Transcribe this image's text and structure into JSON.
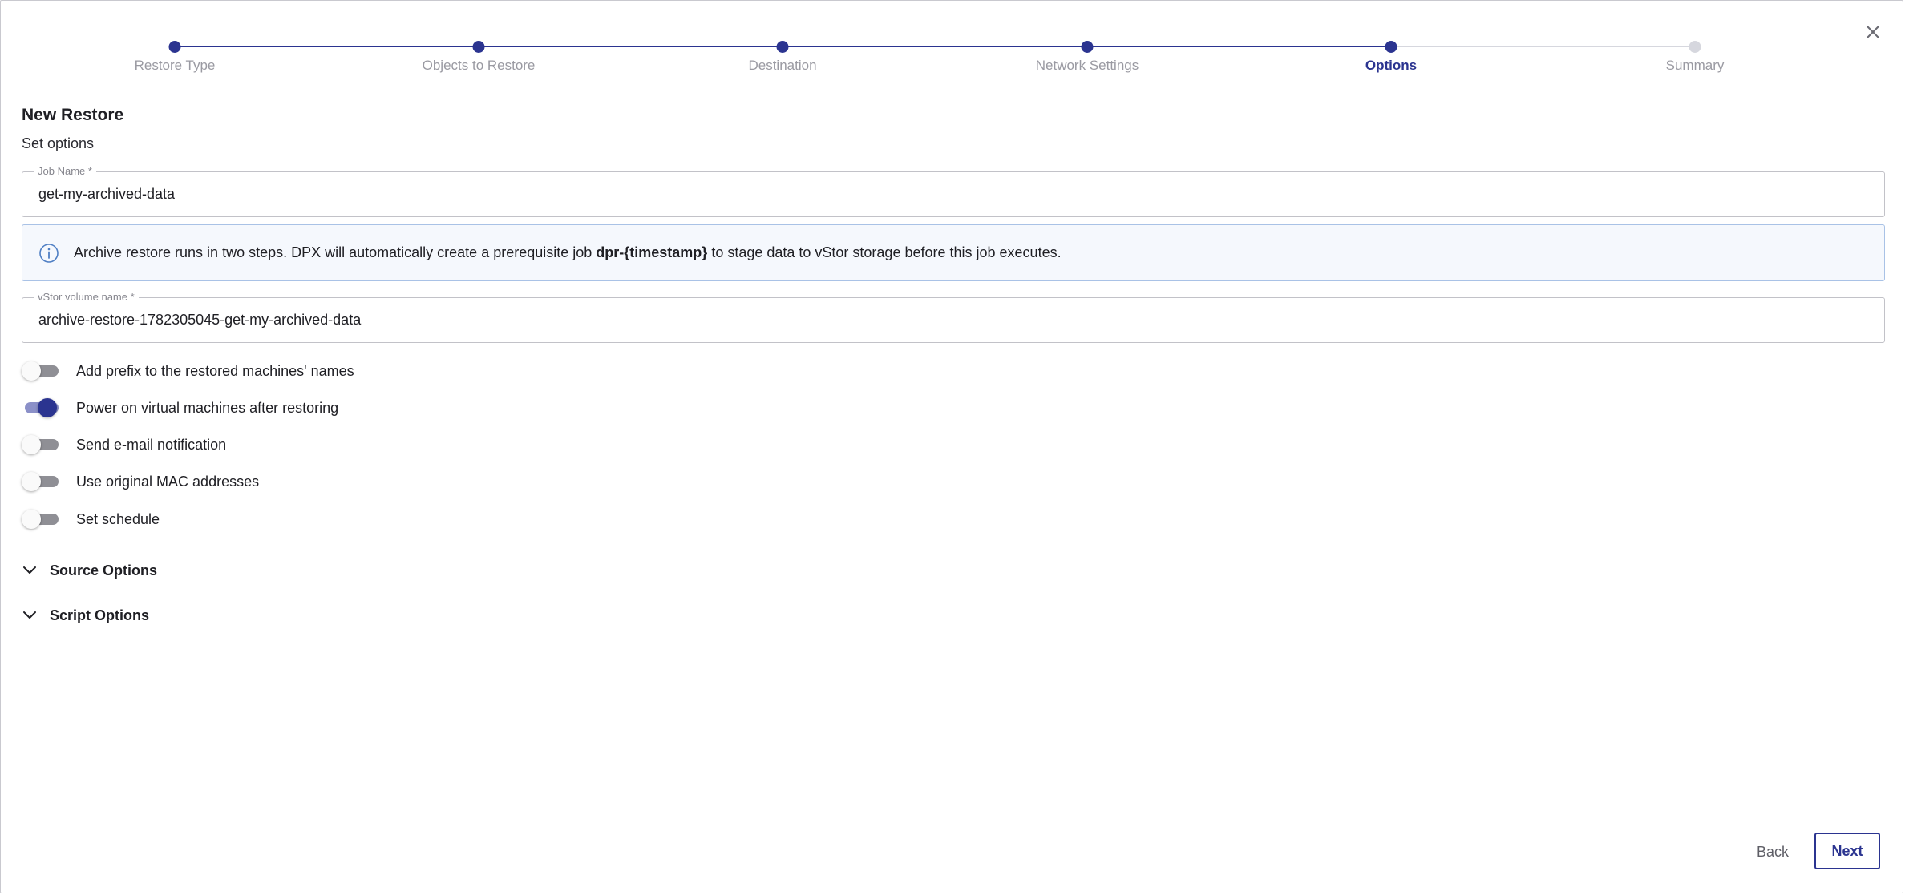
{
  "colors": {
    "accent": "#2b3490",
    "inactive_step": "#d6d7de",
    "info_border": "#a9c2e6",
    "info_background": "#f5f8fd"
  },
  "stepper": {
    "steps": [
      {
        "label": "Restore Type",
        "state": "completed"
      },
      {
        "label": "Objects to Restore",
        "state": "completed"
      },
      {
        "label": "Destination",
        "state": "completed"
      },
      {
        "label": "Network Settings",
        "state": "completed"
      },
      {
        "label": "Options",
        "state": "active"
      },
      {
        "label": "Summary",
        "state": "pending"
      }
    ]
  },
  "dialog": {
    "title": "New Restore",
    "subtitle": "Set options",
    "close_icon": "close-icon"
  },
  "job_name": {
    "label": "Job Name *",
    "value": "get-my-archived-data"
  },
  "info": {
    "icon": "info-icon",
    "text_before": "Archive restore runs in two steps. DPX will automatically create a prerequisite job ",
    "text_bold": "dpr-{timestamp}",
    "text_after": " to stage data to vStor storage before this job executes."
  },
  "vstor_volume": {
    "label": "vStor volume name *",
    "value": "archive-restore-1782305045-get-my-archived-data"
  },
  "toggles": [
    {
      "label": "Add prefix to the restored machines' names",
      "on": false
    },
    {
      "label": "Power on virtual machines after restoring",
      "on": true
    },
    {
      "label": "Send e-mail notification",
      "on": false
    },
    {
      "label": "Use original MAC addresses",
      "on": false
    },
    {
      "label": "Set schedule",
      "on": false
    }
  ],
  "sections": [
    {
      "label": "Source Options",
      "icon": "chevron-down-icon"
    },
    {
      "label": "Script Options",
      "icon": "chevron-down-icon"
    }
  ],
  "footer": {
    "back_label": "Back",
    "next_label": "Next"
  }
}
